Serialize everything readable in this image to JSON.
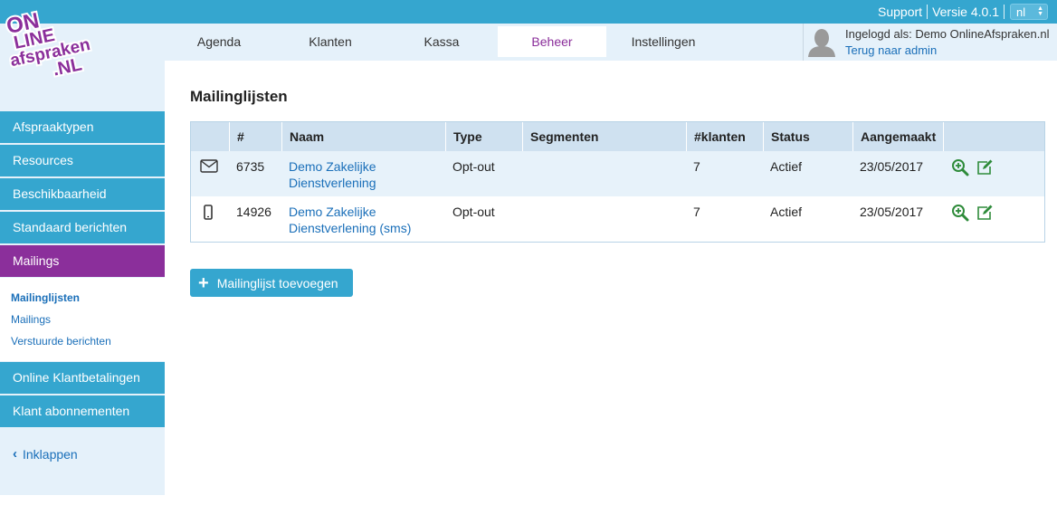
{
  "topbar": {
    "support": "Support",
    "version": "Versie 4.0.1",
    "language": "nl"
  },
  "logo": {
    "line1": "ON",
    "line2": "LINE",
    "line3": "afspraken",
    "line4": ".NL"
  },
  "nav": {
    "tabs": [
      {
        "label": "Agenda"
      },
      {
        "label": "Klanten"
      },
      {
        "label": "Kassa"
      },
      {
        "label": "Beheer"
      },
      {
        "label": "Instellingen"
      }
    ],
    "active_tab": "Beheer"
  },
  "user": {
    "logged_in_as": "Ingelogd als: Demo OnlineAfspraken.nl",
    "back_to_admin": "Terug naar admin"
  },
  "sidebar": {
    "items": [
      {
        "label": "Afspraaktypen"
      },
      {
        "label": "Resources"
      },
      {
        "label": "Beschikbaarheid"
      },
      {
        "label": "Standaard berichten"
      },
      {
        "label": "Mailings"
      },
      {
        "label": "Online Klantbetalingen"
      },
      {
        "label": "Klant abonnementen"
      }
    ],
    "submenu": [
      {
        "label": "Mailinglijsten"
      },
      {
        "label": "Mailings"
      },
      {
        "label": "Verstuurde berichten"
      }
    ],
    "collapse_label": "Inklappen"
  },
  "main": {
    "title": "Mailinglijsten",
    "columns": [
      "#",
      "Naam",
      "Type",
      "Segmenten",
      "#klanten",
      "Status",
      "Aangemaakt"
    ],
    "rows": [
      {
        "icon": "envelope-icon",
        "id": "6735",
        "name_line1": "Demo Zakelijke",
        "name_line2": "Dienstverlening",
        "type": "Opt-out",
        "segments": "",
        "customers": "7",
        "status": "Actief",
        "created": "23/05/2017"
      },
      {
        "icon": "mobile-phone-icon",
        "id": "14926",
        "name_line1": "Demo Zakelijke",
        "name_line2": "Dienstverlening (sms)",
        "type": "Opt-out",
        "segments": "",
        "customers": "7",
        "status": "Actief",
        "created": "23/05/2017"
      }
    ],
    "add_button": "Mailinglijst toevoegen"
  },
  "colors": {
    "primary": "#35a6cf",
    "accent": "#8b2f9b",
    "link": "#1a6fb9",
    "action_green": "#2e8b3a",
    "nav_bg": "#e5f1fa"
  }
}
